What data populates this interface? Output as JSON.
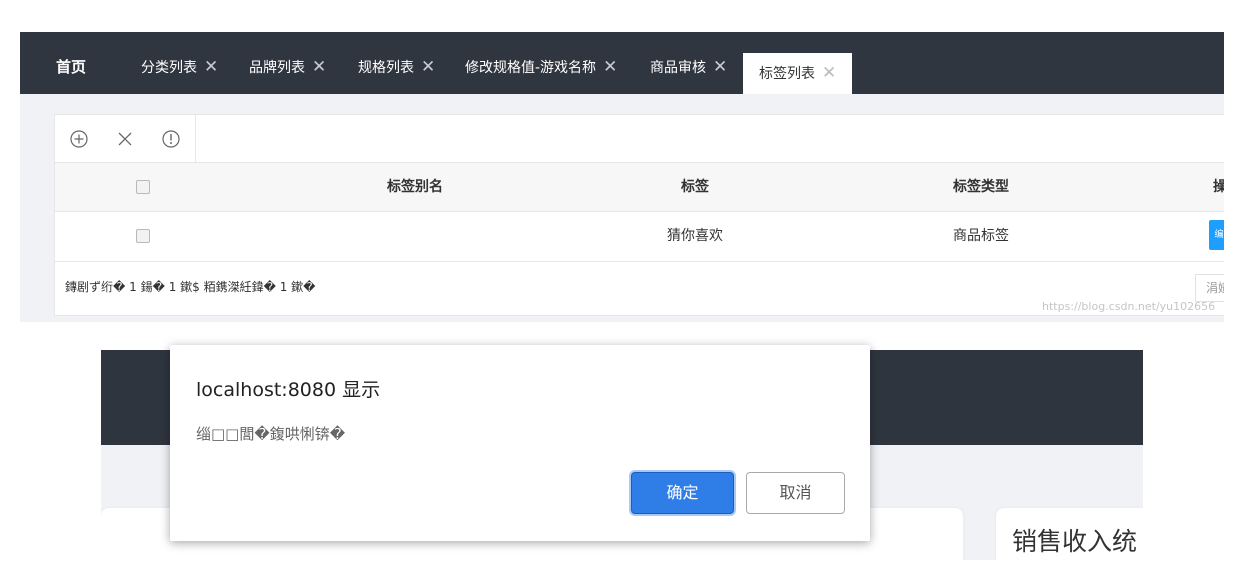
{
  "tabs": {
    "home": "首页",
    "items": [
      {
        "label": "分类列表",
        "close": "✕"
      },
      {
        "label": "品牌列表",
        "close": "✕"
      },
      {
        "label": "规格列表",
        "close": "✕"
      },
      {
        "label": "修改规格值-游戏名称",
        "close": "✕"
      },
      {
        "label": "商品审核",
        "close": "✕"
      },
      {
        "label": "标签列表",
        "close": "✕"
      }
    ]
  },
  "toolbar": {
    "add_icon": "plus-circle-icon",
    "delete_icon": "close-icon",
    "info_icon": "info-circle-icon"
  },
  "table": {
    "columns": [
      "标签别名",
      "标签",
      "标签类型",
      "操"
    ],
    "rows": [
      {
        "alias": "",
        "tag": "猜你喜欢",
        "type": "商品标签",
        "op_label": "编"
      }
    ]
  },
  "footer": {
    "pager_text": "鏄剧ず绗� 1 鍚� 1 鏉$ 粨鎸滐紝鍏� 1 鏉�",
    "next_btn": "涓嬪〉"
  },
  "watermark": "https://blog.csdn.net/yu102656",
  "dialog": {
    "title": "localhost:8080 显示",
    "message": "缁□□閭�鍑哄悧锛�",
    "ok": "确定",
    "cancel": "取消"
  },
  "background": {
    "card_title": "销售收入统"
  },
  "colors": {
    "tabbar": "#303640",
    "primary_btn": "#2f7de6",
    "op_btn": "#1e9fff"
  }
}
